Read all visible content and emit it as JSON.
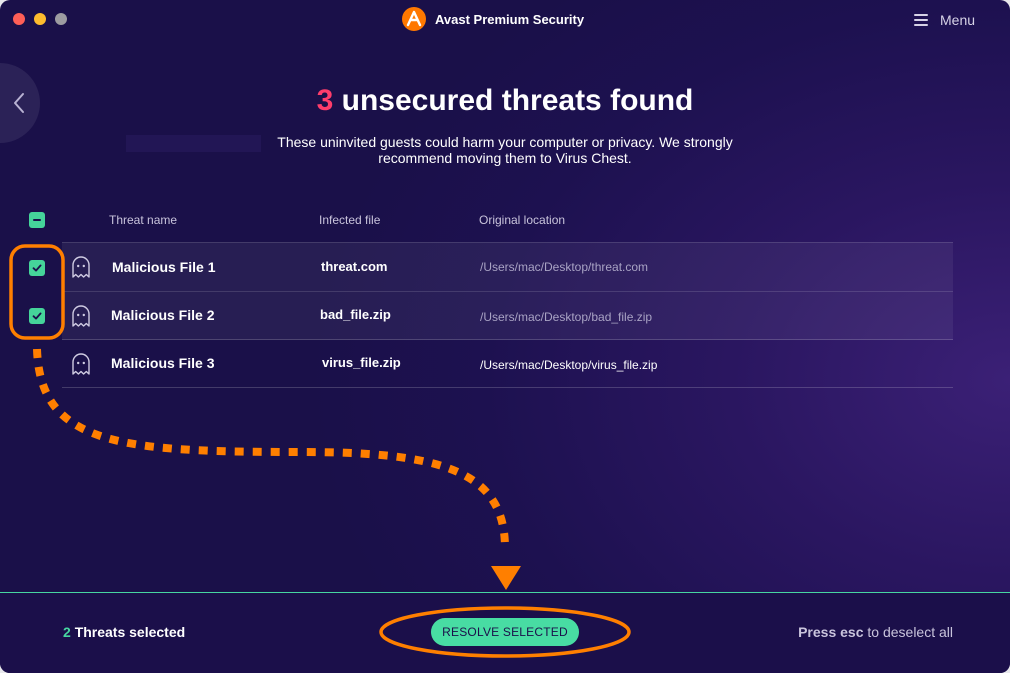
{
  "window": {
    "title": "Avast Premium Security",
    "menu_label": "Menu"
  },
  "heading": {
    "count": "3",
    "text": "unsecured threats found"
  },
  "subtitle": "These uninvited guests could harm your computer or privacy. We strongly recommend moving them to Virus Chest.",
  "table": {
    "columns": [
      "Threat name",
      "Infected file",
      "Original location"
    ],
    "rows": [
      {
        "name": "Malicious File 1",
        "file": "threat.com",
        "location": "/Users/mac/Desktop/threat.com",
        "checked": true
      },
      {
        "name": "Malicious File 2",
        "file": "bad_file.zip",
        "location": "/Users/mac/Desktop/bad_file.zip",
        "checked": true
      },
      {
        "name": "Malicious File 3",
        "file": "virus_file.zip",
        "location": "/Users/mac/Desktop/virus_file.zip",
        "checked": false
      }
    ]
  },
  "footer": {
    "selected_count": "2",
    "selected_label": "Threats selected",
    "resolve_label": "RESOLVE SELECTED",
    "esc_bold": "Press esc",
    "esc_rest": "to deselect all"
  },
  "colors": {
    "accent_green": "#48dca3",
    "threat_pink": "#ff3d6b",
    "annotation_orange": "#ff7f00",
    "brand_orange": "#ff7800"
  },
  "icons": [
    "close-dot",
    "minimize-dot",
    "maximize-dot",
    "avast-logo-icon",
    "menu-icon",
    "back-chevron-icon",
    "ghost-icon",
    "check-icon",
    "minus-icon"
  ]
}
